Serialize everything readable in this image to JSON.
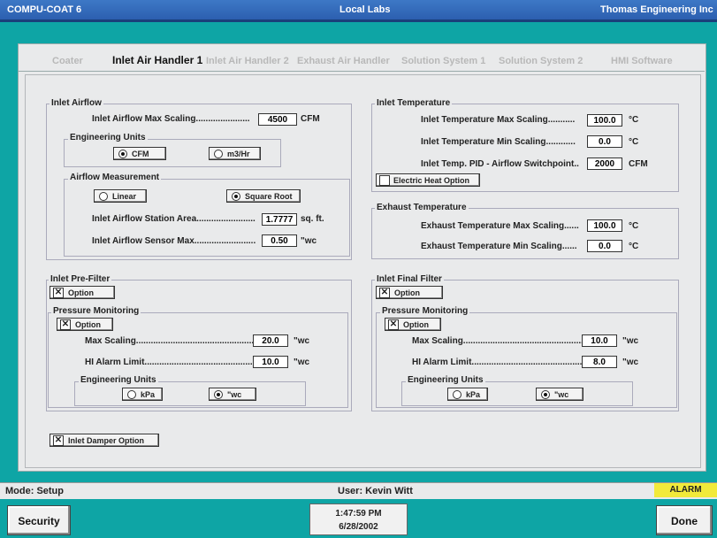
{
  "titlebar": {
    "app": "COMPU-COAT 6",
    "location": "Local Labs",
    "company": "Thomas Engineering Inc"
  },
  "tabs": [
    "Coater",
    "Inlet Air Handler 1",
    "Inlet Air Handler 2",
    "Exhaust Air Handler",
    "Solution System 1",
    "Solution System 2",
    "HMI Software"
  ],
  "active_tab": "Inlet Air Handler 1",
  "inlet_airflow": {
    "title": "Inlet Airflow",
    "max_scaling_label": "Inlet Airflow Max Scaling......................",
    "max_scaling_value": "4500",
    "max_scaling_unit": "CFM",
    "eng_units_title": "Engineering Units",
    "eng_units_options": [
      "CFM",
      "m3/Hr"
    ],
    "eng_units_selected": "CFM",
    "measurement_title": "Airflow Measurement",
    "measurement_options": [
      "Linear",
      "Square Root"
    ],
    "measurement_selected": "Square Root",
    "station_area_label": "Inlet Airflow Station Area........................",
    "station_area_value": "1.7777",
    "station_area_unit": "sq. ft.",
    "sensor_max_label": "Inlet Airflow Sensor Max.........................",
    "sensor_max_value": "0.50",
    "sensor_max_unit": "\"wc"
  },
  "inlet_temperature": {
    "title": "Inlet Temperature",
    "max_label": "Inlet Temperature Max Scaling...........",
    "max_value": "100.0",
    "max_unit": "°C",
    "min_label": "Inlet Temperature Min Scaling............",
    "min_value": "0.0",
    "min_unit": "°C",
    "switch_label": "Inlet Temp. PID - Airflow Switchpoint..",
    "switch_value": "2000",
    "switch_unit": "CFM",
    "electric_heat_label": "Electric Heat Option",
    "electric_heat_checked": false
  },
  "exhaust_temperature": {
    "title": "Exhaust Temperature",
    "max_label": "Exhaust Temperature Max Scaling......",
    "max_value": "100.0",
    "max_unit": "°C",
    "min_label": "Exhaust Temperature Min Scaling......",
    "min_value": "0.0",
    "min_unit": "°C"
  },
  "pre_filter": {
    "title": "Inlet Pre-Filter",
    "option_label": "Option",
    "option_checked": true,
    "pressure_title": "Pressure Monitoring",
    "pressure_option_label": "Option",
    "pressure_option_checked": true,
    "max_label": "Max Scaling..................................................",
    "max_value": "20.0",
    "max_unit": "\"wc",
    "hi_label": "HI Alarm Limit...................................................",
    "hi_value": "10.0",
    "hi_unit": "\"wc",
    "eng_title": "Engineering Units",
    "eng_options": [
      "kPa",
      "\"wc"
    ],
    "eng_selected": "\"wc"
  },
  "final_filter": {
    "title": "Inlet Final Filter",
    "option_label": "Option",
    "option_checked": true,
    "pressure_title": "Pressure Monitoring",
    "pressure_option_label": "Option",
    "pressure_option_checked": true,
    "max_label": "Max Scaling...................................................",
    "max_value": "10.0",
    "max_unit": "\"wc",
    "hi_label": "HI Alarm Limit....................................................",
    "hi_value": "8.0",
    "hi_unit": "\"wc",
    "eng_title": "Engineering Units",
    "eng_options": [
      "kPa",
      "\"wc"
    ],
    "eng_selected": "\"wc"
  },
  "damper": {
    "label": "Inlet Damper Option",
    "checked": true
  },
  "status": {
    "mode": "Mode: Setup",
    "user": "User: Kevin Witt",
    "alarm": "ALARM"
  },
  "bottom": {
    "security": "Security",
    "time": "1:47:59 PM",
    "date": "6/28/2002",
    "done": "Done"
  },
  "colors": {
    "background": "#0ea5a5",
    "titlebar": "#2c5fb0",
    "alarm": "#f2ea3a"
  }
}
